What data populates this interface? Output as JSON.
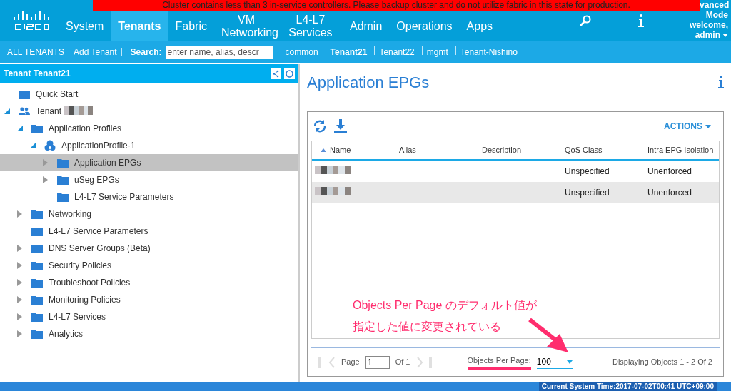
{
  "banner": "Cluster contains less than 3 in-service controllers. Please backup cluster and do not utilize fabric in this state for production.",
  "nav": {
    "items": [
      {
        "label": "System",
        "selected": false
      },
      {
        "label": "Tenants",
        "selected": true
      },
      {
        "label": "Fabric",
        "selected": false
      },
      {
        "label": "VM Networking",
        "selected": false
      },
      {
        "label": "L4-L7 Services",
        "selected": false
      },
      {
        "label": "Admin",
        "selected": false
      },
      {
        "label": "Operations",
        "selected": false
      },
      {
        "label": "Apps",
        "selected": false
      }
    ],
    "mode": "vanced Mode",
    "welcome": "welcome,",
    "user": "admin"
  },
  "subnav": {
    "left": [
      {
        "label": "ALL TENANTS"
      },
      {
        "label": "Add Tenant"
      }
    ],
    "search_label": "Search:",
    "search_placeholder": "enter name, alias, descr",
    "tenants": [
      {
        "label": "common",
        "selected": false
      },
      {
        "label": "Tenant21",
        "selected": true
      },
      {
        "label": "Tenant22",
        "selected": false
      },
      {
        "label": "mgmt",
        "selected": false
      },
      {
        "label": "Tenant-Nishino",
        "selected": false
      }
    ]
  },
  "tree": {
    "title": "Tenant Tenant21",
    "items": [
      {
        "label": "Quick Start",
        "kind": "folder",
        "selected": false
      },
      {
        "label": "Tenant",
        "kind": "tenant",
        "redacted": true,
        "expanded": true,
        "selected": false,
        "children": [
          {
            "label": "Application Profiles",
            "kind": "folder",
            "expanded": true,
            "selected": false,
            "children": [
              {
                "label": "ApplicationProfile-1",
                "kind": "profile",
                "expanded": true,
                "selected": false,
                "children": [
                  {
                    "label": "Application EPGs",
                    "kind": "folder",
                    "expanded": false,
                    "selected": true
                  },
                  {
                    "label": "uSeg EPGs",
                    "kind": "folder",
                    "expanded": false,
                    "selected": false
                  },
                  {
                    "label": "L4-L7 Service Parameters",
                    "kind": "folder",
                    "selected": false
                  }
                ]
              }
            ]
          },
          {
            "label": "Networking",
            "kind": "folder",
            "expanded": false,
            "selected": false
          },
          {
            "label": "L4-L7 Service Parameters",
            "kind": "folder",
            "selected": false
          },
          {
            "label": "DNS Server Groups (Beta)",
            "kind": "folder",
            "expanded": false,
            "selected": false
          },
          {
            "label": "Security Policies",
            "kind": "folder",
            "expanded": false,
            "selected": false
          },
          {
            "label": "Troubleshoot Policies",
            "kind": "folder",
            "expanded": false,
            "selected": false
          },
          {
            "label": "Monitoring Policies",
            "kind": "folder",
            "expanded": false,
            "selected": false
          },
          {
            "label": "L4-L7 Services",
            "kind": "folder",
            "expanded": false,
            "selected": false
          },
          {
            "label": "Analytics",
            "kind": "folder",
            "expanded": false,
            "selected": false
          }
        ]
      }
    ]
  },
  "content": {
    "title": "Application EPGs",
    "actions": "ACTIONS",
    "table": {
      "columns": [
        "Name",
        "Alias",
        "Description",
        "QoS Class",
        "Intra EPG Isolation"
      ],
      "rows": [
        {
          "name_redacted": true,
          "qos": "Unspecified",
          "isolation": "Unenforced"
        },
        {
          "name_redacted": true,
          "qos": "Unspecified",
          "isolation": "Unenforced"
        }
      ]
    },
    "pager": {
      "page_label": "Page",
      "page": "1",
      "of": "Of 1",
      "per_page_label": "Objects Per Page:",
      "per_page": "100",
      "displaying": "Displaying Objects 1 - 2 Of 2"
    },
    "annotation": [
      "Objects Per Page のデフォルト値が",
      "指定した値に変更されている"
    ]
  },
  "status_bar": "Current System Time:2017-07-02T00:41 UTC+09:00"
}
